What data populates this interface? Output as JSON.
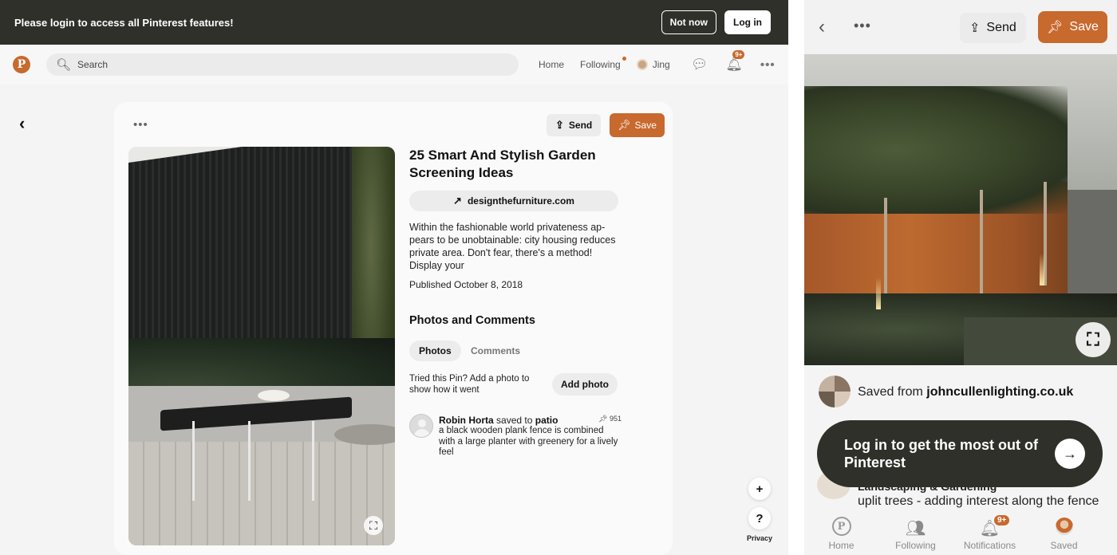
{
  "banner": {
    "message": "Please login to access all Pinterest features!",
    "not_now": "Not now",
    "login": "Log in"
  },
  "nav": {
    "logo": "P",
    "search_placeholder": "Search",
    "home": "Home",
    "following": "Following",
    "user": "Jing",
    "notif_count": "9+"
  },
  "pin": {
    "send": "Send",
    "save": "Save",
    "title": "25 Smart And Stylish Garden Screening Ideas",
    "source": "designthefurniture.com",
    "description": "Within the fashionable world privateness ap­pears to be unobtainable: city housing re­duces private area. Don't fear, there's a method! Display your",
    "published": "Published October 8, 2018",
    "photos_comments_heading": "Photos and Comments",
    "tab_photos": "Photos",
    "tab_comments": "Comments",
    "tried_text": "Tried this Pin? Add a photo to show how it went",
    "add_photo": "Add photo",
    "comment": {
      "author": "Robin Horta",
      "saved_to": "saved to",
      "board": "patio",
      "pin_count": "951",
      "text": "a black wooden plank fence is combined with a large planter with greenery for a live­ly feel"
    }
  },
  "floating": {
    "plus": "+",
    "help": "?",
    "privacy": "Privacy"
  },
  "mobile": {
    "send": "Send",
    "save": "Save",
    "saved_from_prefix": "Saved from",
    "saved_from_site": "johncullenlighting.co.uk",
    "login_prompt": "Log in to get the most out of Pinterest",
    "board_name": "Landscaping & Gardening",
    "board_desc": "uplit trees - adding interest along the fence",
    "tabs": [
      {
        "label": "Home"
      },
      {
        "label": "Following"
      },
      {
        "label": "Notifications",
        "badge": "9+"
      },
      {
        "label": "Saved"
      }
    ]
  },
  "colors": {
    "accent": "#c8692e",
    "banner_bg": "#2f3029"
  }
}
